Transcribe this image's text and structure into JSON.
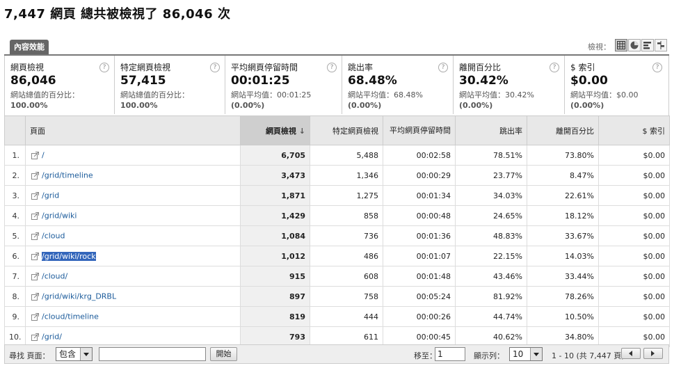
{
  "headline": "7,447 網頁 總共被檢視了 86,046 次",
  "tab_label": "內容效能",
  "view_label": "檢視：",
  "view_buttons": [
    {
      "name": "table-view-icon",
      "active": true
    },
    {
      "name": "pie-view-icon",
      "active": false
    },
    {
      "name": "bar-view-icon",
      "active": false
    },
    {
      "name": "comparison-view-icon",
      "active": false
    }
  ],
  "metrics": [
    {
      "title": "網頁檢視",
      "value": "86,046",
      "sub1": "網站總值的百分比：",
      "sub2": "100.00%"
    },
    {
      "title": "特定網頁檢視",
      "value": "57,415",
      "sub1": "網站總值的百分比：",
      "sub2": "100.00%"
    },
    {
      "title": "平均網頁停留時間",
      "value": "00:01:25",
      "sub1": "網站平均值：00:01:25",
      "sub2": "(0.00%)"
    },
    {
      "title": "跳出率",
      "value": "68.48%",
      "sub1": "網站平均值：68.48%",
      "sub2": "(0.00%)"
    },
    {
      "title": "離開百分比",
      "value": "30.42%",
      "sub1": "網站平均值：30.42%",
      "sub2": "(0.00%)"
    },
    {
      "title": "$ 索引",
      "value": "$0.00",
      "sub1": "網站平均值：$0.00",
      "sub2": "(0.00%)"
    }
  ],
  "help_glyph": "?",
  "columns": {
    "page": "頁面",
    "pageviews": "網頁檢視",
    "sort_arrow": "↓",
    "unique": "特定網頁檢視",
    "avg_time": "平均網頁停留時間",
    "bounce": "跳出率",
    "exit": "離開百分比",
    "index": "$ 索引"
  },
  "rows": [
    {
      "rank": "1.",
      "page": "/",
      "pageviews": "6,705",
      "unique": "5,488",
      "avg_time": "00:02:58",
      "bounce": "78.51%",
      "exit": "73.80%",
      "index": "$0.00"
    },
    {
      "rank": "2.",
      "page": "/grid/timeline",
      "pageviews": "3,473",
      "unique": "1,346",
      "avg_time": "00:00:29",
      "bounce": "23.77%",
      "exit": "8.47%",
      "index": "$0.00"
    },
    {
      "rank": "3.",
      "page": "/grid",
      "pageviews": "1,871",
      "unique": "1,275",
      "avg_time": "00:01:34",
      "bounce": "34.03%",
      "exit": "22.61%",
      "index": "$0.00"
    },
    {
      "rank": "4.",
      "page": "/grid/wiki",
      "pageviews": "1,429",
      "unique": "858",
      "avg_time": "00:00:48",
      "bounce": "24.65%",
      "exit": "18.12%",
      "index": "$0.00"
    },
    {
      "rank": "5.",
      "page": "/cloud",
      "pageviews": "1,084",
      "unique": "736",
      "avg_time": "00:01:36",
      "bounce": "48.83%",
      "exit": "33.67%",
      "index": "$0.00"
    },
    {
      "rank": "6.",
      "page": "/grid/wiki/rock",
      "pageviews": "1,012",
      "unique": "486",
      "avg_time": "00:01:07",
      "bounce": "22.15%",
      "exit": "14.03%",
      "index": "$0.00",
      "selected": true
    },
    {
      "rank": "7.",
      "page": "/cloud/",
      "pageviews": "915",
      "unique": "608",
      "avg_time": "00:01:48",
      "bounce": "43.46%",
      "exit": "33.44%",
      "index": "$0.00"
    },
    {
      "rank": "8.",
      "page": "/grid/wiki/krg_DRBL",
      "pageviews": "897",
      "unique": "758",
      "avg_time": "00:05:24",
      "bounce": "81.92%",
      "exit": "78.26%",
      "index": "$0.00"
    },
    {
      "rank": "9.",
      "page": "/cloud/timeline",
      "pageviews": "819",
      "unique": "444",
      "avg_time": "00:00:26",
      "bounce": "44.74%",
      "exit": "10.50%",
      "index": "$0.00"
    },
    {
      "rank": "10.",
      "page": "/grid/",
      "pageviews": "793",
      "unique": "611",
      "avg_time": "00:00:45",
      "bounce": "40.62%",
      "exit": "34.80%",
      "index": "$0.00"
    }
  ],
  "footer": {
    "find_label": "尋找 頁面：",
    "match_option": "包含",
    "search_value": "",
    "go_label": "開始",
    "goto_label": "移至：",
    "goto_value": "1",
    "show_label": "顯示列：",
    "show_value": "10",
    "range_text": "1 - 10 (共 7,447 頁)"
  },
  "colors": {
    "link": "#1a5a9a",
    "selection": "#3366bb",
    "tab": "#666666"
  }
}
